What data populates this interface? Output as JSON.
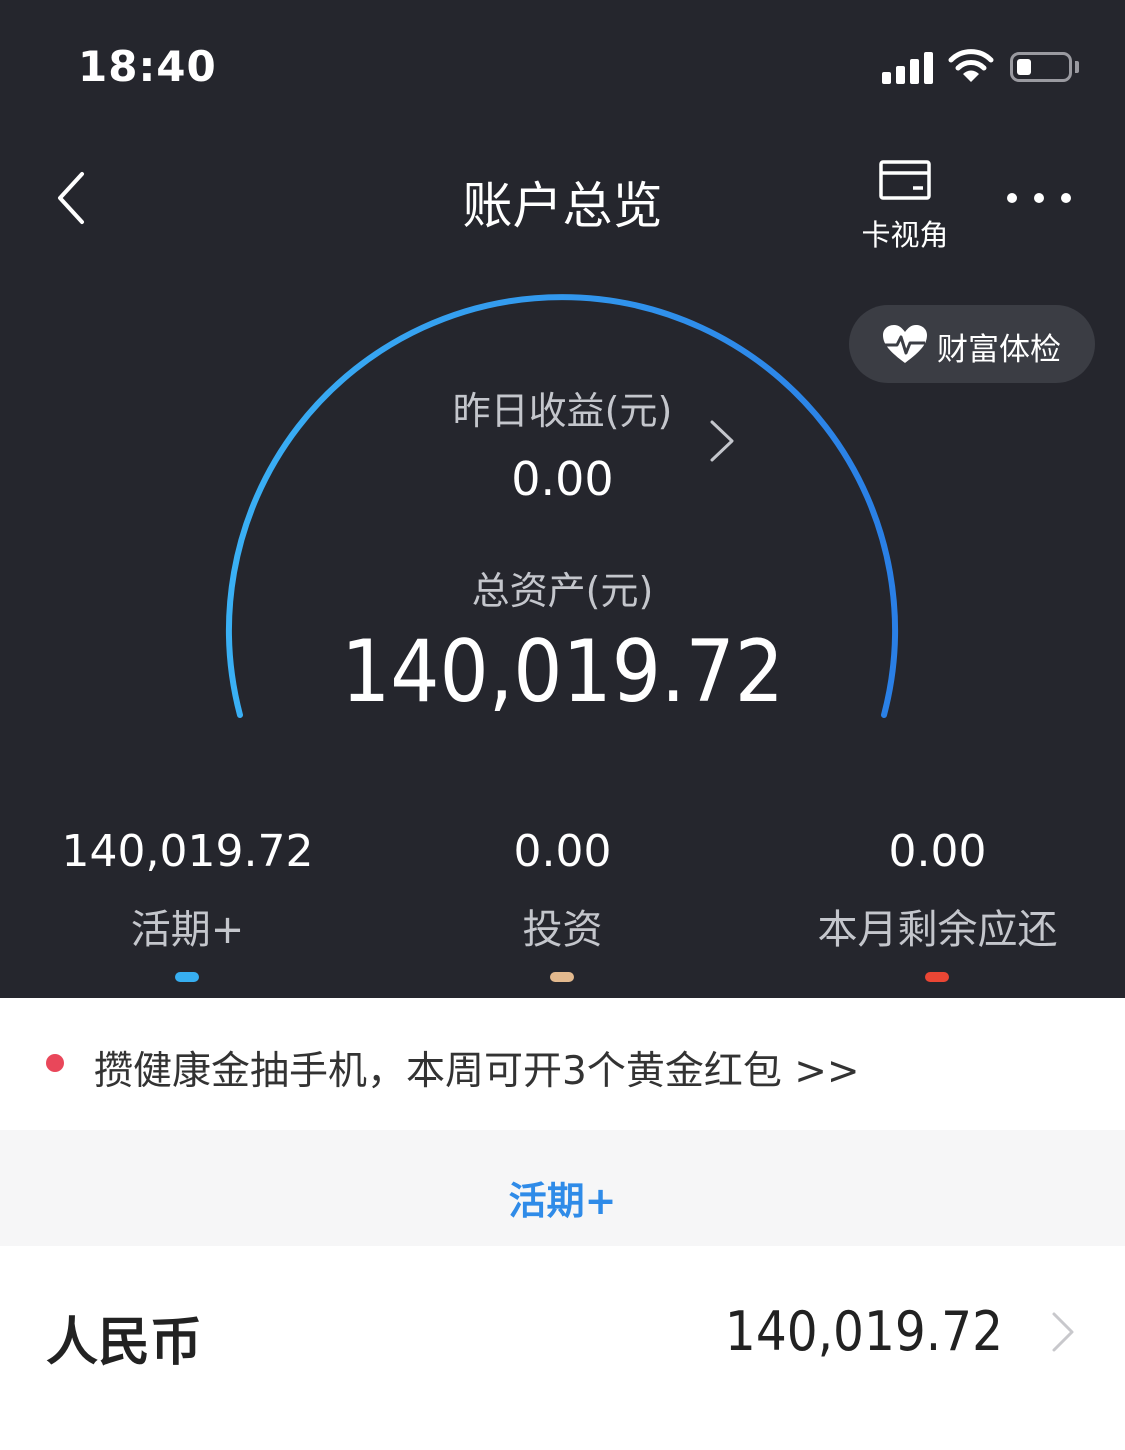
{
  "status_bar": {
    "time": "18:40",
    "icons": [
      "signal-icon",
      "wifi-icon",
      "battery-icon"
    ]
  },
  "nav": {
    "title": "账户总览",
    "card_view_label": "卡视角",
    "icons": [
      "back-chevron-icon",
      "card-icon",
      "more-icon"
    ]
  },
  "health_check": {
    "label": "财富体检",
    "icon": "heart-pulse-icon"
  },
  "gauge": {
    "yesterday_label": "昨日收益(元)",
    "yesterday_value": "0.00",
    "total_label": "总资产(元)",
    "total_value": "140,019.72",
    "arc_color_start": "#3ab0f5",
    "arc_color_end": "#2a7fe6"
  },
  "summary": [
    {
      "value": "140,019.72",
      "label": "活期+",
      "color": "#37aef0"
    },
    {
      "value": "0.00",
      "label": "投资",
      "color": "#e3b98e"
    },
    {
      "value": "0.00",
      "label": "本月剩余应还",
      "color": "#ea4634"
    }
  ],
  "promo": {
    "text": "攒健康金抽手机，本周可开3个黄金红包 >>",
    "dot_color": "#e9475a"
  },
  "section": {
    "title": "活期+",
    "color": "#2f8be8"
  },
  "rows": [
    {
      "label": "人民币",
      "value": "140,019.72"
    }
  ]
}
